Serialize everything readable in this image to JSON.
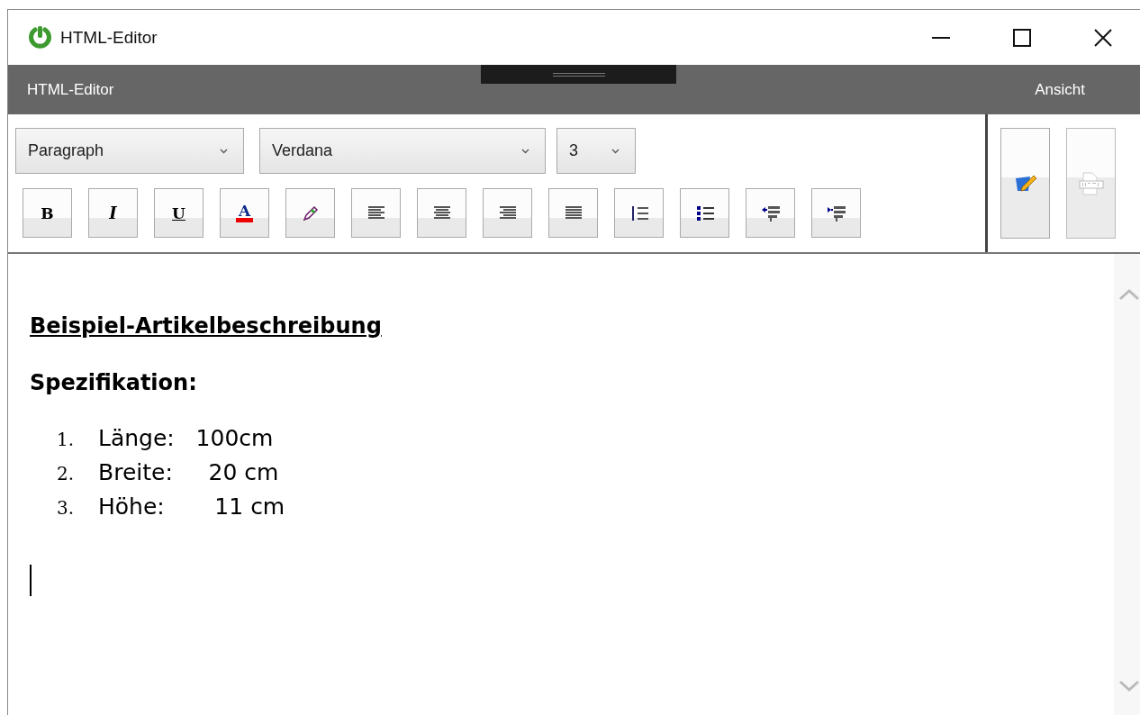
{
  "window": {
    "title": "HTML-Editor"
  },
  "ribbon": {
    "left_label": "HTML-Editor",
    "right_label": "Ansicht"
  },
  "dropdowns": [
    {
      "kind": "block",
      "value": "Paragraph"
    },
    {
      "kind": "font",
      "value": "Verdana"
    },
    {
      "kind": "size",
      "value": "3"
    }
  ],
  "toolbar": [
    {
      "kind": "bold",
      "label": "B"
    },
    {
      "kind": "italic",
      "label": "I"
    },
    {
      "kind": "underline",
      "label": "U"
    },
    {
      "kind": "font-color",
      "label": "A"
    },
    {
      "kind": "highlight"
    },
    {
      "kind": "align-left"
    },
    {
      "kind": "align-center"
    },
    {
      "kind": "align-right"
    },
    {
      "kind": "justify"
    },
    {
      "kind": "ordered-list"
    },
    {
      "kind": "bullet-list"
    },
    {
      "kind": "outdent"
    },
    {
      "kind": "indent"
    }
  ],
  "view_buttons": [
    {
      "kind": "design",
      "disabled": false
    },
    {
      "kind": "html",
      "disabled": true
    }
  ],
  "document": {
    "heading": "Beispiel-Artikelbeschreibung",
    "subheading": "Spezifikation:",
    "list": [
      {
        "number": "1.",
        "text": "Länge:   100cm"
      },
      {
        "number": "2.",
        "text": "Breite:     20 cm"
      },
      {
        "number": "3.",
        "text": "Höhe:       11 cm"
      }
    ],
    "caret": true
  }
}
